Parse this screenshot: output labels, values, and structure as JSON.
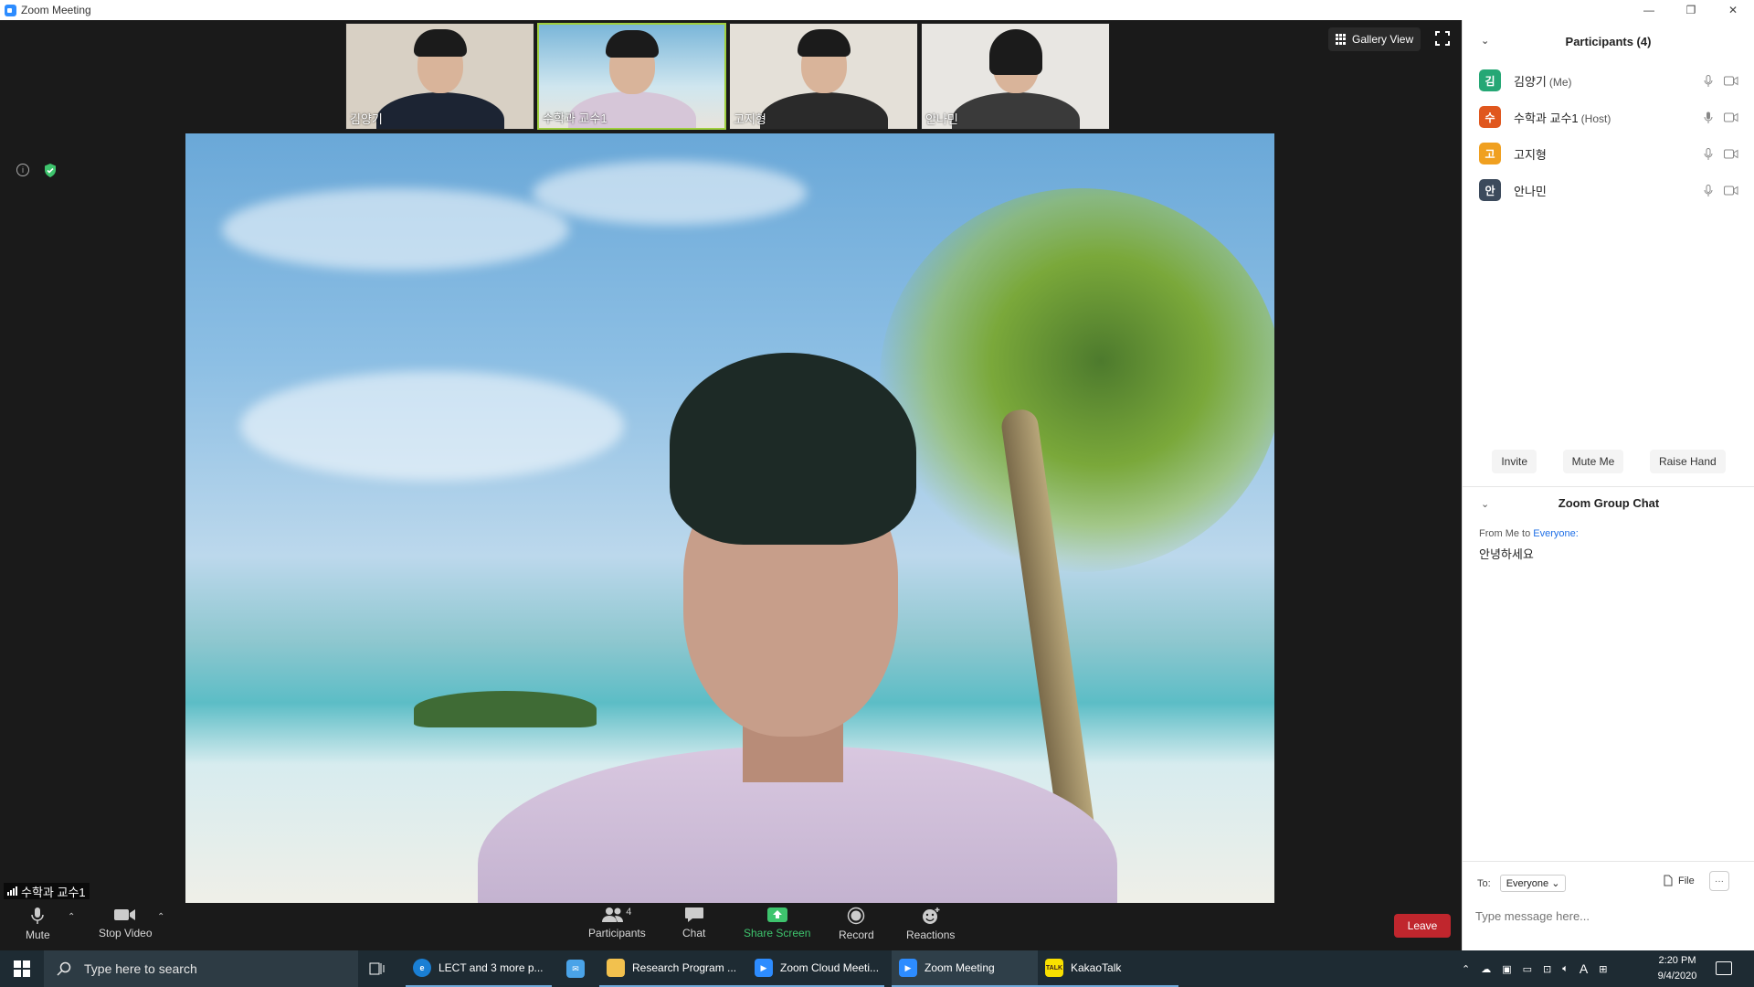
{
  "window": {
    "title": "Zoom Meeting",
    "controls": [
      "—",
      "❐",
      "✕"
    ]
  },
  "thumbnails": [
    {
      "name": "김양기",
      "bg": "#d8d0c4",
      "active": false
    },
    {
      "name": "수학과 교수1",
      "bg": "#7ab6d9",
      "active": true
    },
    {
      "name": "고지형",
      "bg": "#e4e0d8",
      "active": false
    },
    {
      "name": "안나민",
      "bg": "#e8e6e2",
      "active": false
    }
  ],
  "view": {
    "gallery_label": "Gallery View"
  },
  "main": {
    "speaker_name": "수학과 교수1"
  },
  "toolbar": {
    "mute": "Mute",
    "stop_video": "Stop Video",
    "participants_count": "4",
    "participants": "Participants",
    "chat": "Chat",
    "share_screen": "Share Screen",
    "record": "Record",
    "reactions": "Reactions",
    "leave": "Leave"
  },
  "participants_panel": {
    "title": "Participants (4)",
    "items": [
      {
        "initial": "김",
        "name": "김양기",
        "role": "(Me)",
        "color": "#25a775"
      },
      {
        "initial": "수",
        "name": "수학과 교수1",
        "role": "(Host)",
        "color": "#e0571e"
      },
      {
        "initial": "고",
        "name": "고지형",
        "role": "",
        "color": "#f0a020"
      },
      {
        "initial": "안",
        "name": "안나민",
        "role": "",
        "color": "#3c4a5c"
      }
    ],
    "actions": {
      "invite": "Invite",
      "mute_me": "Mute Me",
      "raise_hand": "Raise Hand"
    }
  },
  "chat": {
    "title": "Zoom Group Chat",
    "from_prefix": "From Me to",
    "to_target": "Everyone:",
    "message": "안녕하세요",
    "to_label": "To:",
    "to_value": "Everyone",
    "file_label": "File",
    "more_label": "···",
    "placeholder": "Type message here..."
  },
  "taskbar": {
    "search_placeholder": "Type here to search",
    "apps": [
      {
        "label": "LECT and 3 more p...",
        "icon_color": "#1a7fd4",
        "icon_text": "e"
      },
      {
        "label": "",
        "icon_color": "#4aa3e8",
        "icon_text": "✉"
      },
      {
        "label": "Research Program ...",
        "icon_color": "#f2c14e",
        "icon_text": ""
      },
      {
        "label": "Zoom Cloud Meeti...",
        "icon_color": "#2d8cff",
        "icon_text": "▶"
      },
      {
        "label": "Zoom Meeting",
        "icon_color": "#2d8cff",
        "icon_text": "▶"
      },
      {
        "label": "KakaoTalk",
        "icon_color": "#f9e000",
        "icon_text": "TALK"
      }
    ],
    "ime": "A",
    "time": "2:20 PM",
    "date": "9/4/2020"
  }
}
